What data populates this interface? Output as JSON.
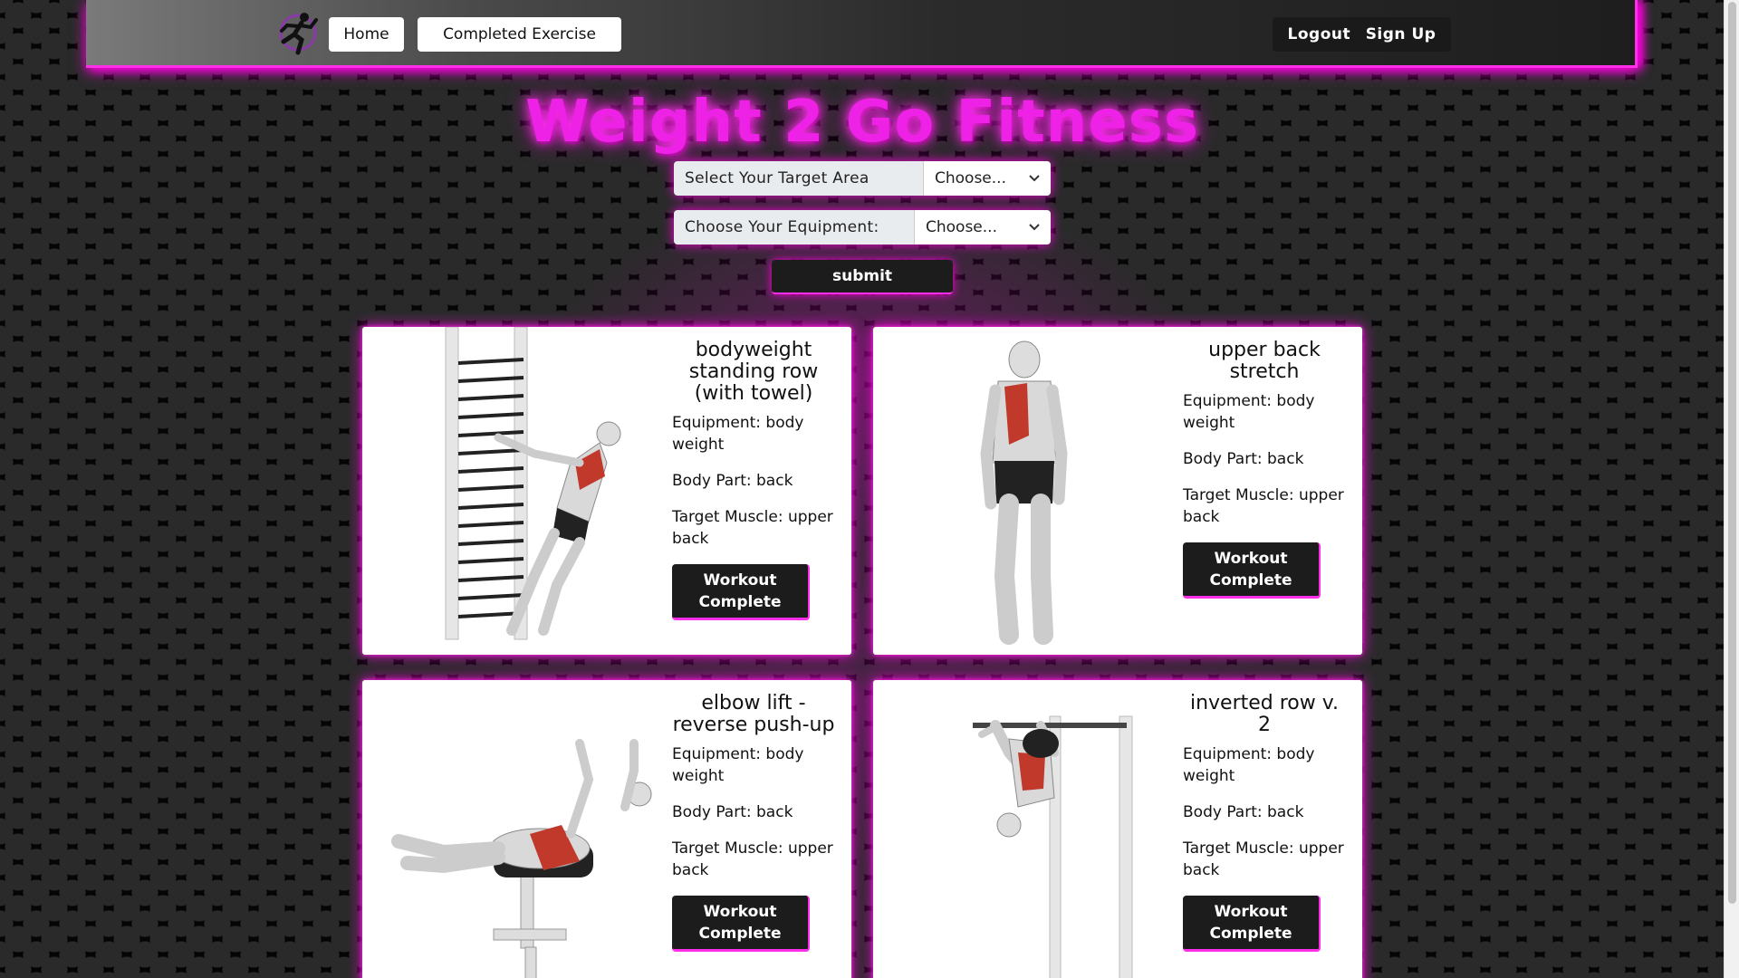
{
  "nav": {
    "home_label": "Home",
    "completed_label": "Completed Exercise",
    "logout_label": "Logout",
    "signup_label": "Sign Up",
    "logo_icon": "running-man-logo-icon"
  },
  "page": {
    "title": "Weight 2 Go Fitness"
  },
  "form": {
    "target_label": "Select Your Target Area",
    "target_value": "Choose...",
    "equipment_label": "Choose Your Equipment:",
    "equipment_value": "Choose...",
    "submit_label": "submit"
  },
  "exercises": [
    {
      "name": "bodyweight standing row (with towel)",
      "equipment": "Equipment: body weight",
      "body_part": "Body Part: back",
      "target": "Target Muscle: upper back",
      "button": "Workout Complete"
    },
    {
      "name": "upper back stretch",
      "equipment": "Equipment: body weight",
      "body_part": "Body Part: back",
      "target": "Target Muscle: upper back",
      "button": "Workout Complete"
    },
    {
      "name": "elbow lift - reverse push-up",
      "equipment": "Equipment: body weight",
      "body_part": "Body Part: back",
      "target": "Target Muscle: upper back",
      "button": "Workout Complete"
    },
    {
      "name": "inverted row v. 2",
      "equipment": "Equipment: body weight",
      "body_part": "Body Part: back",
      "target": "Target Muscle: upper back",
      "button": "Workout Complete"
    }
  ],
  "colors": {
    "accent": "#ff00e0",
    "title": "#ee22e6",
    "button_dark": "#1c1c1c"
  }
}
